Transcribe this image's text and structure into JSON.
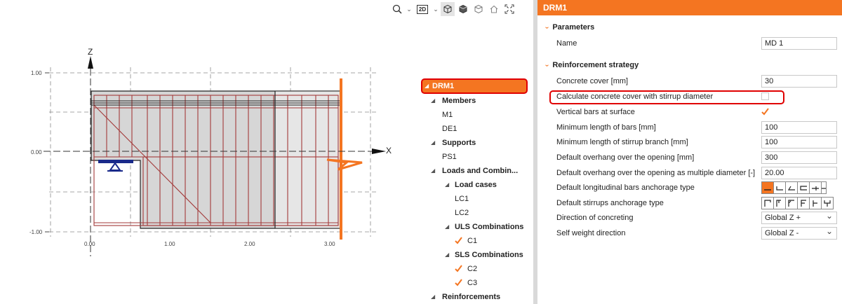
{
  "toolbar": {
    "view_mode": "2D",
    "icons": [
      "zoom-icon",
      "view-mode-2d-icon",
      "wireframe-icon",
      "solid-icon",
      "transparent-icon",
      "home-icon",
      "fit-screen-icon"
    ]
  },
  "canvas": {
    "z_axis": "Z",
    "x_axis": "X",
    "y_ticks": [
      "1.00",
      "0.00",
      "-1.00"
    ],
    "x_ticks": [
      "0.00",
      "1.00",
      "2.00",
      "3.00"
    ],
    "colors": {
      "rebar": "#a33a3a",
      "accent": "#f47521",
      "support": "#1a2a8a",
      "concrete": "#d9d9d9"
    }
  },
  "tree": {
    "root": "DRM1",
    "members": {
      "label": "Members",
      "items": [
        "M1",
        "DE1"
      ]
    },
    "supports": {
      "label": "Supports",
      "items": [
        "PS1"
      ]
    },
    "loads": {
      "label": "Loads and Combin...",
      "load_cases": {
        "label": "Load cases",
        "items": [
          "LC1",
          "LC2"
        ]
      },
      "uls": {
        "label": "ULS Combinations",
        "items": [
          "C1"
        ]
      },
      "sls": {
        "label": "SLS Combinations",
        "items": [
          "C2",
          "C3"
        ]
      }
    },
    "reinforcements": "Reinforcements"
  },
  "properties": {
    "header": "DRM1",
    "parameters": {
      "title": "Parameters",
      "name_label": "Name",
      "name_value": "MD 1"
    },
    "reinforcement": {
      "title": "Reinforcement strategy",
      "concrete_cover_label": "Concrete cover [mm]",
      "concrete_cover_value": "30",
      "calc_cover_label": "Calculate concrete cover with stirrup diameter",
      "calc_cover_checked": false,
      "vertical_bars_label": "Vertical bars at surface",
      "vertical_bars_checked": true,
      "min_bar_length_label": "Minimum length of bars [mm]",
      "min_bar_length_value": "100",
      "min_stirrup_branch_label": "Minimum length of stirrup branch [mm]",
      "min_stirrup_branch_value": "100",
      "overhang_label": "Default overhang over the opening [mm]",
      "overhang_value": "300",
      "overhang_multiple_label": "Default overhang over the opening as multiple diameter [-]",
      "overhang_multiple_value": "20.00",
      "long_anchorage_label": "Default longitudinal bars anchorage type",
      "stirrup_anchorage_label": "Default stirrups anchorage type",
      "concreting_dir_label": "Direction of concreting",
      "concreting_dir_value": "Global Z +",
      "self_weight_label": "Self weight direction",
      "self_weight_value": "Global Z -"
    }
  }
}
